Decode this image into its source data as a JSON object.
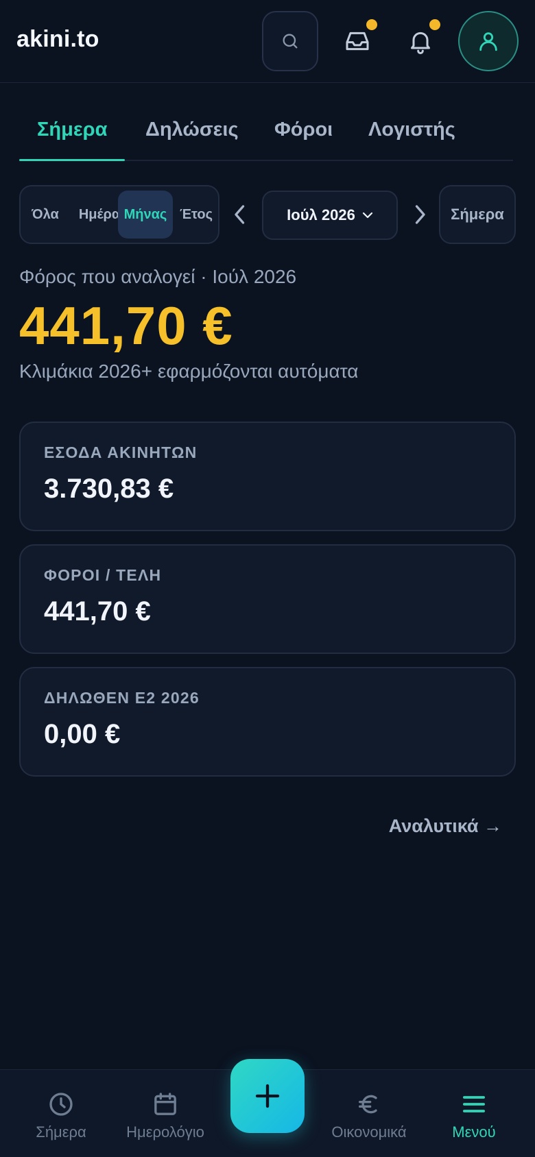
{
  "header": {
    "logo": "akini.to",
    "icons": [
      "search-icon",
      "inbox-icon",
      "bell-icon",
      "user-icon"
    ]
  },
  "tabs": [
    {
      "label": "Σήμερα",
      "active": true
    },
    {
      "label": "Δηλώσεις",
      "active": false
    },
    {
      "label": "Φόροι",
      "active": false
    },
    {
      "label": "Λογιστής",
      "active": false
    }
  ],
  "period": {
    "options": [
      "Όλα",
      "Ημέρα",
      "Μήνας",
      "Έτος"
    ],
    "selected": "Μήνας",
    "current": "Ιούλ 2026",
    "today_label": "Σήμερα"
  },
  "summary": {
    "label": "Φόρος που αναλογεί · Ιούλ 2026",
    "amount": "441,70 €",
    "note": "Κλιμάκια 2026+ εφαρμόζονται αυτόματα"
  },
  "cards": [
    {
      "label": "ΕΣΟΔΑ ΑΚΙΝΗΤΩΝ",
      "value": "3.730,83 €"
    },
    {
      "label": "ΦΟΡΟΙ / ΤΕΛΗ",
      "value": "441,70 €"
    },
    {
      "label": "ΔΗΛΩΘΕΝ Ε2 2026",
      "value": "0,00 €"
    }
  ],
  "details_link": "Αναλυτικά →",
  "bottom_nav": [
    {
      "label": "Σήμερα",
      "icon": "clock-icon",
      "active": false
    },
    {
      "label": "Ημερολόγιο",
      "icon": "calendar-icon",
      "active": false
    },
    {
      "label": "Οικονομικά",
      "icon": "euro-icon",
      "active": false
    },
    {
      "label": "Μενού",
      "icon": "menu-icon",
      "active": true
    }
  ],
  "colors": {
    "background": "#0b1220",
    "accent": "#2fd6b8",
    "amount": "#f6c02a",
    "notification_dot": "#f5b82a"
  }
}
